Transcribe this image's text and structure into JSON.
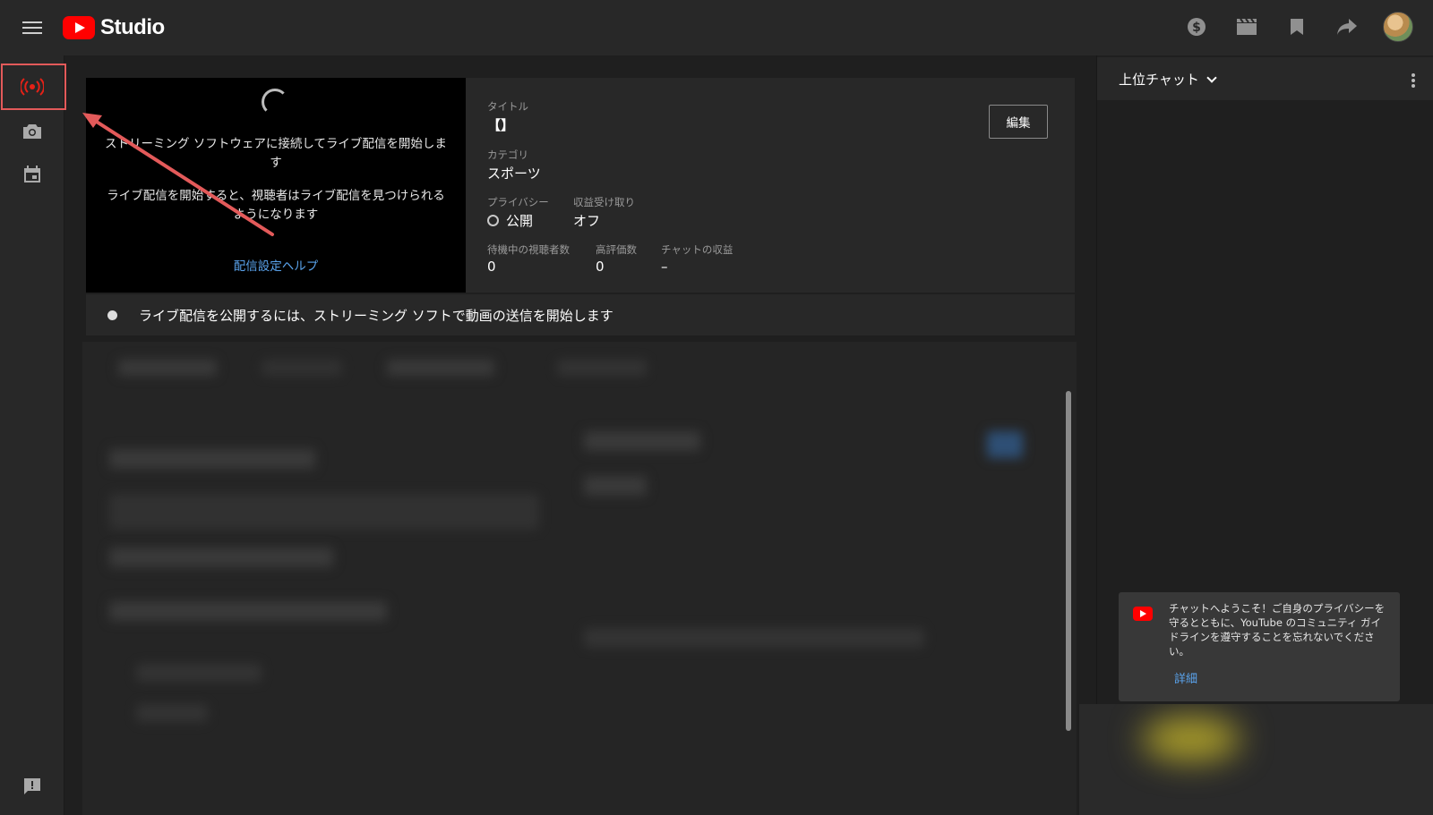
{
  "header": {
    "logo_text": "Studio",
    "icons": [
      "monetization-icon",
      "clapperboard-icon",
      "bookmark-icon",
      "share-icon",
      "avatar"
    ]
  },
  "leftnav": {
    "items": [
      "live-stream-icon",
      "camera-icon",
      "calendar-icon"
    ],
    "bottom": "feedback-icon"
  },
  "preview": {
    "message1": "ストリーミング ソフトウェアに接続してライブ配信を開始します",
    "message2": "ライブ配信を開始すると、視聴者はライブ配信を見つけられるようになります",
    "help_link": "配信設定ヘルプ"
  },
  "info": {
    "title_label": "タイトル",
    "title_value": "【】",
    "category_label": "カテゴリ",
    "category_value": "スポーツ",
    "privacy_label": "プライバシー",
    "privacy_value": "公開",
    "monetization_label": "収益受け取り",
    "monetization_value": "オフ",
    "waiting_viewers_label": "待機中の視聴者数",
    "waiting_viewers_value": "0",
    "likes_label": "高評価数",
    "likes_value": "0",
    "chat_revenue_label": "チャットの収益",
    "chat_revenue_value": "–",
    "edit_button": "編集"
  },
  "status": {
    "text": "ライブ配信を公開するには、ストリーミング ソフトで動画の送信を開始します"
  },
  "chat": {
    "title": "上位チャット",
    "welcome_text": "チャットへようこそ！ご自身のプライバシーを守るとともに、YouTube のコミュニティ ガイドラインを遵守することを忘れないでください。",
    "welcome_link": "詳細"
  },
  "colors": {
    "accent_red": "#ff0000",
    "link_blue": "#5aa3ec",
    "highlight_annotation": "#e35a5a"
  }
}
